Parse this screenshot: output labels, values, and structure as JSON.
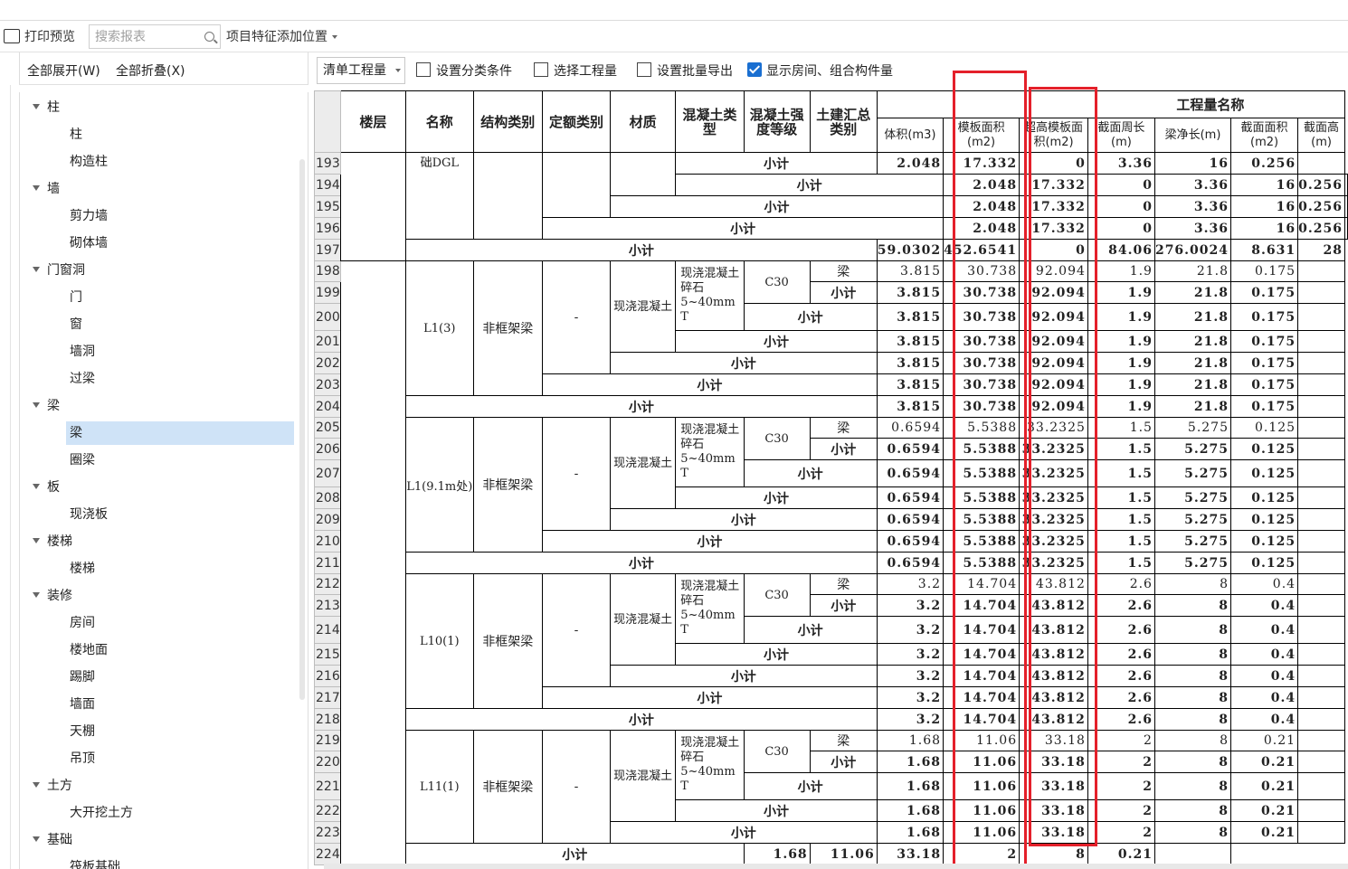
{
  "toolbar": {
    "print_preview": "打印预览",
    "search_placeholder": "搜索报表",
    "feature_position": "项目特征添加位置"
  },
  "left_panel": {
    "expand_all": "全部展开(W)",
    "collapse_all": "全部折叠(X)",
    "tree": [
      {
        "label": "柱",
        "type": "cat"
      },
      {
        "label": "柱",
        "type": "child"
      },
      {
        "label": "构造柱",
        "type": "child"
      },
      {
        "label": "墙",
        "type": "cat"
      },
      {
        "label": "剪力墙",
        "type": "child"
      },
      {
        "label": "砌体墙",
        "type": "child"
      },
      {
        "label": "门窗洞",
        "type": "cat"
      },
      {
        "label": "门",
        "type": "child"
      },
      {
        "label": "窗",
        "type": "child"
      },
      {
        "label": "墙洞",
        "type": "child"
      },
      {
        "label": "过梁",
        "type": "child"
      },
      {
        "label": "梁",
        "type": "cat"
      },
      {
        "label": "梁",
        "type": "child",
        "selected": true
      },
      {
        "label": "圈梁",
        "type": "child"
      },
      {
        "label": "板",
        "type": "cat"
      },
      {
        "label": "现浇板",
        "type": "child"
      },
      {
        "label": "楼梯",
        "type": "cat"
      },
      {
        "label": "楼梯",
        "type": "child"
      },
      {
        "label": "装修",
        "type": "cat"
      },
      {
        "label": "房间",
        "type": "child"
      },
      {
        "label": "楼地面",
        "type": "child"
      },
      {
        "label": "踢脚",
        "type": "child"
      },
      {
        "label": "墙面",
        "type": "child"
      },
      {
        "label": "天棚",
        "type": "child"
      },
      {
        "label": "吊顶",
        "type": "child"
      },
      {
        "label": "土方",
        "type": "cat"
      },
      {
        "label": "大开挖土方",
        "type": "child"
      },
      {
        "label": "基础",
        "type": "cat"
      },
      {
        "label": "筏板基础",
        "type": "child"
      }
    ]
  },
  "toolbar2": {
    "qty_select": "清单工程量",
    "set_classification": "设置分类条件",
    "select_quantity": "选择工程量",
    "batch_export": "设置批量导出",
    "show_room": "显示房间、组合构件量"
  },
  "table": {
    "headers": {
      "floor": "楼层",
      "name": "名称",
      "struct_type": "结构类别",
      "quota_type": "定额类别",
      "material": "材质",
      "concrete_type": "混凝土类型",
      "concrete_grade": "混凝土强度等级",
      "civil_type": "土建汇总类别",
      "qty_group": "工程量名称",
      "cols": [
        "体积(m3)",
        "模板面积(m2)",
        "超高模板面积(m2)",
        "截面周长(m)",
        "梁净长(m)",
        "截面面积(m2)",
        "截面高(m)"
      ]
    },
    "labels": {
      "subtotal": "小计",
      "beam": "梁",
      "frame_beam": "非框架梁",
      "dash": "-",
      "cast_in_place": "现浇混凝土",
      "material_desc": "现浇混凝土 碎石5~40mm T",
      "grade": "C30",
      "top_name": "础DGL"
    },
    "top_rows": [
      {
        "rn": "193",
        "vals": [
          "2.048",
          "17.332",
          "0",
          "3.36",
          "16",
          "0.256",
          ""
        ]
      },
      {
        "rn": "194",
        "vals": [
          "2.048",
          "17.332",
          "0",
          "3.36",
          "16",
          "0.256",
          ""
        ]
      },
      {
        "rn": "195",
        "vals": [
          "2.048",
          "17.332",
          "0",
          "3.36",
          "16",
          "0.256",
          ""
        ]
      },
      {
        "rn": "196",
        "vals": [
          "2.048",
          "17.332",
          "0",
          "3.36",
          "16",
          "0.256",
          ""
        ]
      },
      {
        "rn": "197",
        "vals": [
          "59.0302",
          "452.6541",
          "0",
          "84.06",
          "276.0024",
          "8.631",
          "28"
        ]
      }
    ],
    "groups": [
      {
        "name": "L1(3)",
        "rns": [
          "198",
          "199",
          "200",
          "201",
          "202",
          "203",
          "204"
        ],
        "vals": [
          "3.815",
          "30.738",
          "92.094",
          "1.9",
          "21.8",
          "0.175",
          ""
        ]
      },
      {
        "name": "L1(9.1m处)",
        "rns": [
          "205",
          "206",
          "207",
          "208",
          "209",
          "210",
          "211"
        ],
        "vals": [
          "0.6594",
          "5.5388",
          "33.2325",
          "1.5",
          "5.275",
          "0.125",
          ""
        ]
      },
      {
        "name": "L10(1)",
        "rns": [
          "212",
          "213",
          "214",
          "215",
          "216",
          "217",
          "218"
        ],
        "vals": [
          "3.2",
          "14.704",
          "43.812",
          "2.6",
          "8",
          "0.4",
          ""
        ]
      },
      {
        "name": "L11(1)",
        "rns": [
          "219",
          "220",
          "221",
          "222",
          "223",
          "224"
        ],
        "vals": [
          "1.68",
          "11.06",
          "33.18",
          "2",
          "8",
          "0.21",
          ""
        ]
      }
    ]
  },
  "colors": {
    "highlight": "#e4202a",
    "selected_row": "#cfe3f7",
    "checkbox": "#1a6fd1"
  }
}
